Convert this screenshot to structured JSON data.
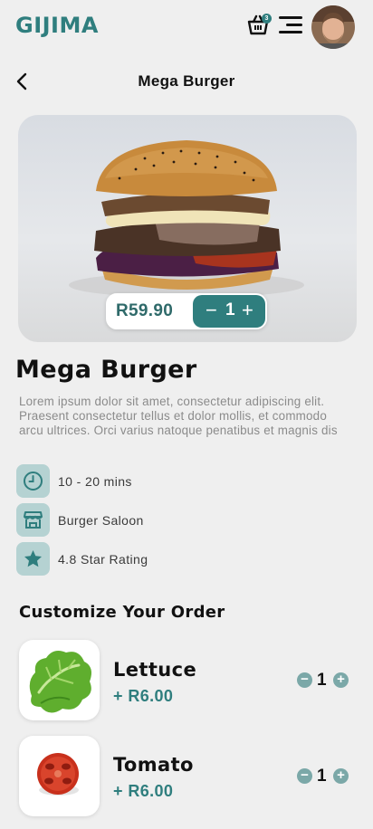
{
  "header": {
    "logo": "GIJIMA",
    "cart_count": "3",
    "icons": [
      "basket-icon",
      "menu-icon",
      "avatar"
    ]
  },
  "nav": {
    "title": "Mega Burger"
  },
  "product": {
    "price": "R59.90",
    "quantity": "1",
    "decrement": "−",
    "increment": "+",
    "title": "Mega Burger",
    "description": "Lorem ipsum dolor sit amet, consectetur adipiscing elit. Praesent consectetur tellus et dolor mollis, et commodo arcu ultrices. Orci varius natoque penatibus et magnis dis",
    "info": [
      {
        "icon": "clock-icon",
        "text": "10 - 20 mins"
      },
      {
        "icon": "store-icon",
        "text": "Burger Saloon"
      },
      {
        "icon": "star-icon",
        "text": "4.8 Star Rating"
      }
    ]
  },
  "customize": {
    "title": "Customize Your Order",
    "items": [
      {
        "name": "Lettuce",
        "price": "+ R6.00",
        "quantity": "1",
        "icon": "lettuce-image"
      },
      {
        "name": "Tomato",
        "price": "+ R6.00",
        "quantity": "1",
        "icon": "tomato-image"
      }
    ]
  },
  "colors": {
    "accent": "#2f7e7e",
    "icon_bg": "#b5d2d2",
    "background": "#efefef"
  }
}
